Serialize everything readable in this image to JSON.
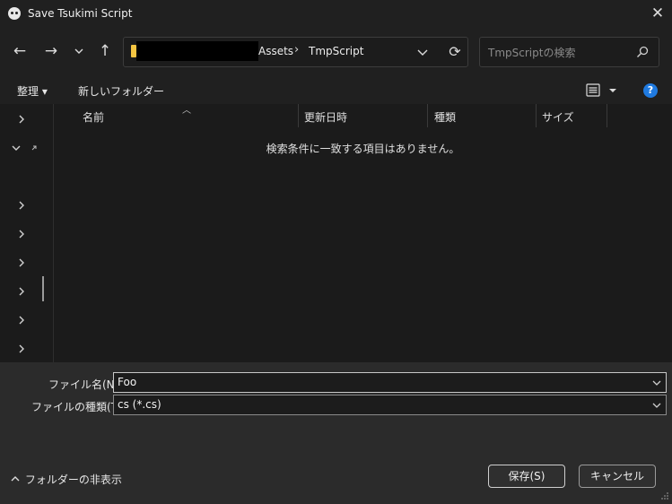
{
  "window": {
    "title": "Save Tsukimi Script",
    "close_icon": "close-icon"
  },
  "nav": {
    "back_icon": "arrow-left-icon",
    "forward_icon": "arrow-right-icon",
    "recent_icon": "chevron-down-icon",
    "up_icon": "arrow-up-icon",
    "breadcrumbs": [
      "Assets",
      "TmpScript"
    ],
    "breadcrumb_sep": "›",
    "refresh_icon": "refresh-icon",
    "search_placeholder": "TmpScriptの検索"
  },
  "commandbar": {
    "organize": "整理 ▾",
    "new_folder": "新しいフォルダー",
    "help": "?"
  },
  "columns": [
    "名前",
    "更新日時",
    "種類",
    "サイズ"
  ],
  "empty_message": "検索条件に一致する項目はありません。",
  "form": {
    "filename_label": "ファイル名(N):",
    "filename_value": "Foo",
    "filetype_label": "ファイルの種類(T):",
    "filetype_value": "cs (*.cs)"
  },
  "footer": {
    "hide_folders": "フォルダーの非表示",
    "save": "保存(S)",
    "cancel": "キャンセル"
  },
  "colors": {
    "background": "#1b1b1b",
    "help_accent": "#1f7ae0",
    "folder_accent": "#f5c542"
  }
}
